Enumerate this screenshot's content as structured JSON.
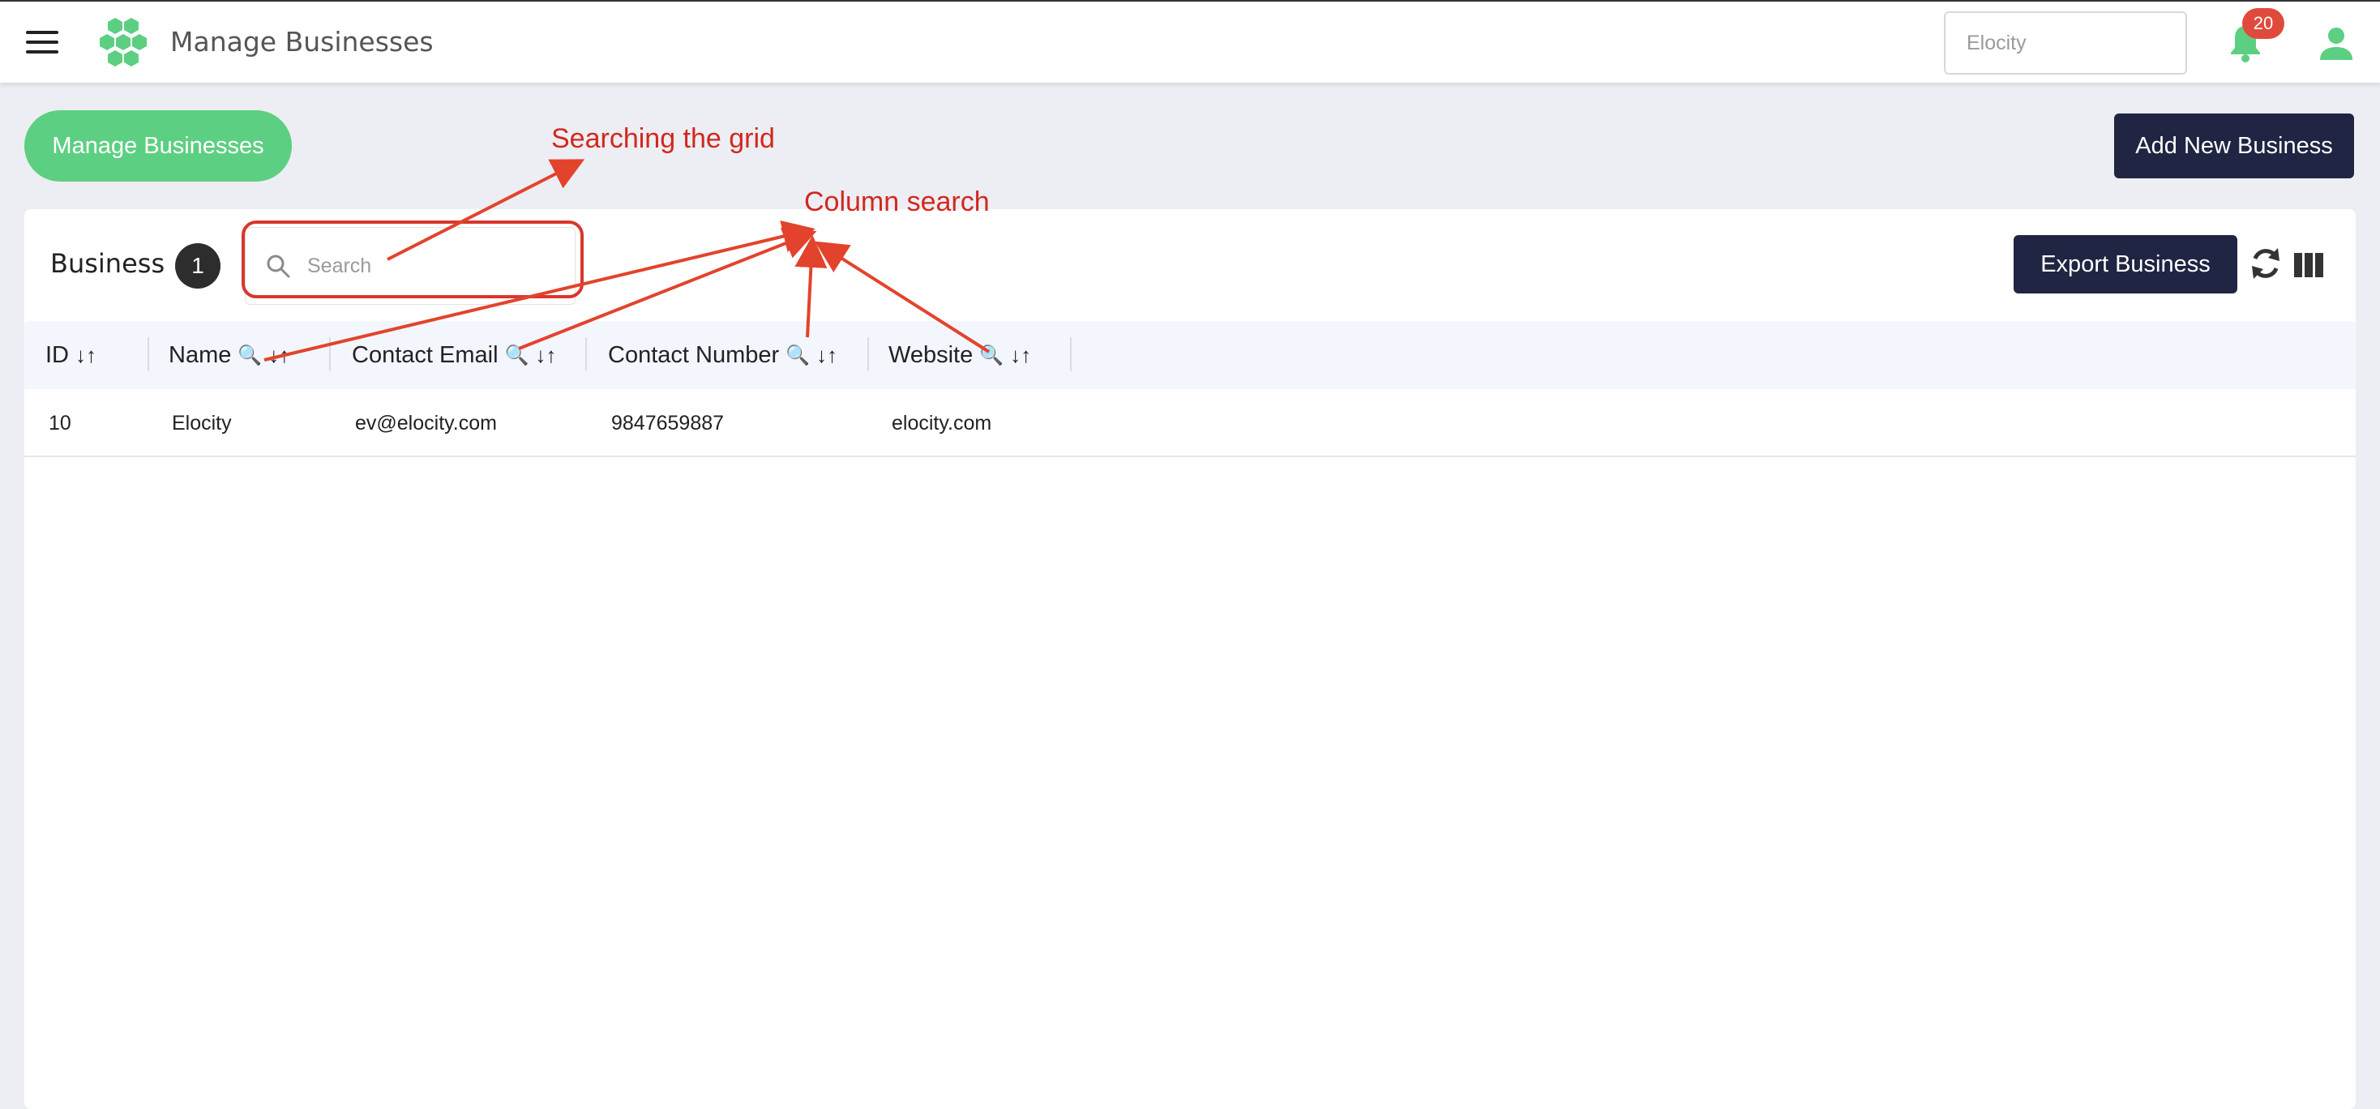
{
  "header": {
    "app_title": "Manage Businesses",
    "org_selector_value": "Elocity",
    "notification_count": "20"
  },
  "page": {
    "breadcrumb_pill": "Manage Businesses",
    "add_button": "Add New Business"
  },
  "card": {
    "title": "Business",
    "count": "1",
    "search_placeholder": "Search",
    "export_button": "Export Business"
  },
  "table": {
    "columns": [
      {
        "label": "ID",
        "sort": "↓↑",
        "search": ""
      },
      {
        "label": "Name",
        "sort": "↓↑",
        "search": "🔍"
      },
      {
        "label": "Contact Email",
        "sort": "↓↑",
        "search": "🔍"
      },
      {
        "label": "Contact Number",
        "sort": "↓↑",
        "search": "🔍"
      },
      {
        "label": "Website",
        "sort": "↓↑",
        "search": "🔍"
      }
    ],
    "rows": [
      [
        "10",
        "Elocity",
        "ev@elocity.com",
        "9847659887",
        "elocity.com"
      ]
    ]
  },
  "annotations": {
    "grid_search": "Searching the grid",
    "column_search": "Column search"
  },
  "colors": {
    "brand_green": "#5dcf82",
    "navy": "#1f2542",
    "annotation_red": "#d3271d",
    "badge_red": "#e04a3c"
  },
  "icons": [
    "menu-icon",
    "logo-icon",
    "bell-icon",
    "user-icon",
    "search-icon",
    "refresh-icon",
    "columns-icon"
  ]
}
